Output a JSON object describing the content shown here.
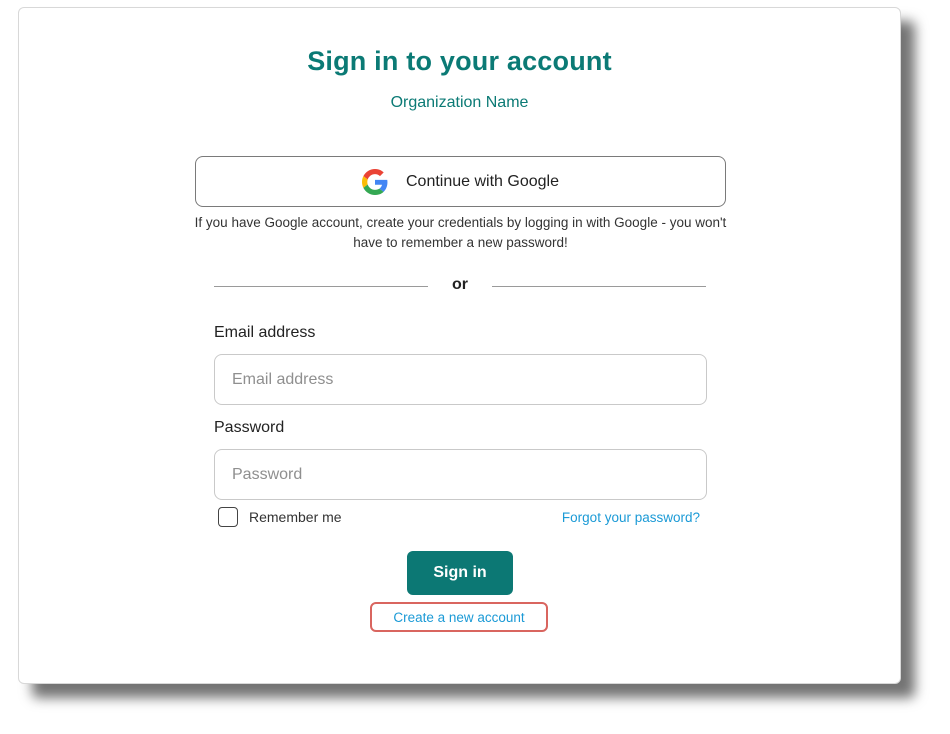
{
  "page": {
    "title": "Sign in to your account",
    "organization": "Organization Name"
  },
  "google": {
    "button_label": "Continue with Google",
    "icon": "google-logo-icon",
    "hint": "If you have Google account, create your credentials by logging in with Google - you won't have to remember a new password!"
  },
  "divider": {
    "label": "or"
  },
  "form": {
    "email": {
      "label": "Email address",
      "placeholder": "Email address",
      "value": ""
    },
    "password": {
      "label": "Password",
      "placeholder": "Password",
      "value": ""
    },
    "remember_me": {
      "label": "Remember me",
      "checked": false
    },
    "forgot_password": "Forgot your password?",
    "submit_label": "Sign in",
    "create_account": "Create a new account"
  },
  "colors": {
    "brand": "#0b7a75",
    "link": "#1b9ad6",
    "highlight": "#d9655f"
  }
}
